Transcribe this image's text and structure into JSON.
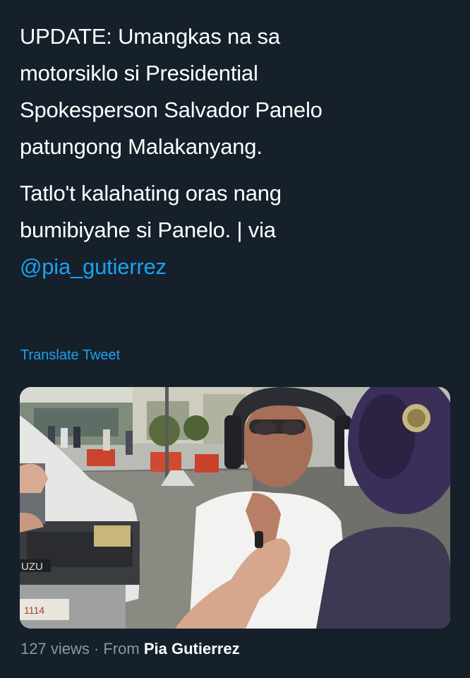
{
  "tweet": {
    "paragraph1": [
      "UPDATE: Umangkas na sa",
      "motorsiklo si Presidential",
      "Spokesperson Salvador Panelo",
      "patungong Malakanyang."
    ],
    "paragraph2": [
      "Tatlo't kalahating oras nang",
      "bumibiyahe si Panelo. | via"
    ],
    "mention": "@pia_gutierrez",
    "translate_label": "Translate Tweet"
  },
  "media": {
    "vehicle_badge": "UZU",
    "plate_text": "1114"
  },
  "footer": {
    "views": "127 views",
    "separator": "·",
    "from_label": "From",
    "source_name": "Pia Gutierrez"
  },
  "colors": {
    "background": "#15202b",
    "link": "#1da1f2",
    "secondary_text": "#8899a6"
  }
}
